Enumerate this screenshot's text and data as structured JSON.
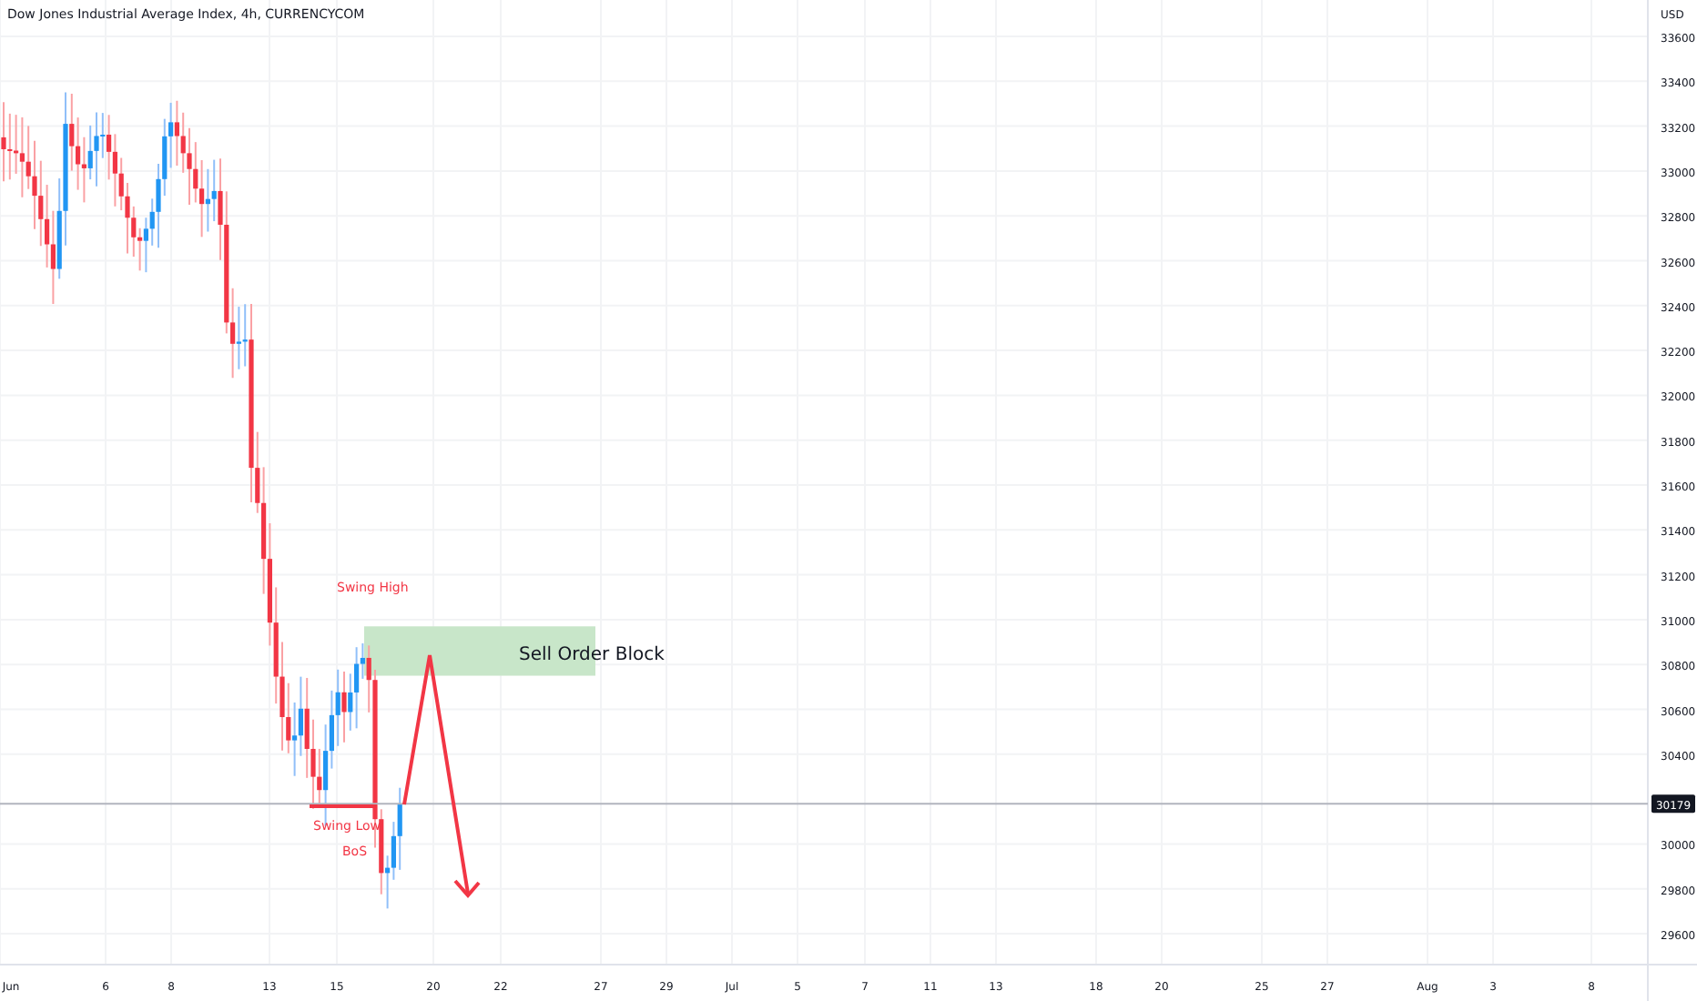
{
  "chart": {
    "title": "Dow Jones Industrial Average Index, 4h, CURRENCYCOM",
    "price_axis": {
      "currency": "USD",
      "ticks": [
        "33600",
        "33400",
        "33200",
        "33000",
        "32800",
        "32600",
        "32400",
        "32200",
        "32000",
        "31800",
        "31600",
        "31400",
        "31200",
        "31000",
        "30800",
        "30600",
        "30400",
        "30000",
        "29800",
        "29600"
      ],
      "current_price": "30179"
    },
    "time_axis": [
      "Jun",
      "6",
      "8",
      "13",
      "15",
      "20",
      "22",
      "27",
      "29",
      "Jul",
      "5",
      "7",
      "11",
      "13",
      "18",
      "20",
      "25",
      "27",
      "Aug",
      "3",
      "8"
    ],
    "annotations": {
      "swing_high": "Swing High",
      "order_block": "Sell Order Block",
      "swing_low": "Swing Low",
      "break_of_structure": "BoS"
    }
  }
}
